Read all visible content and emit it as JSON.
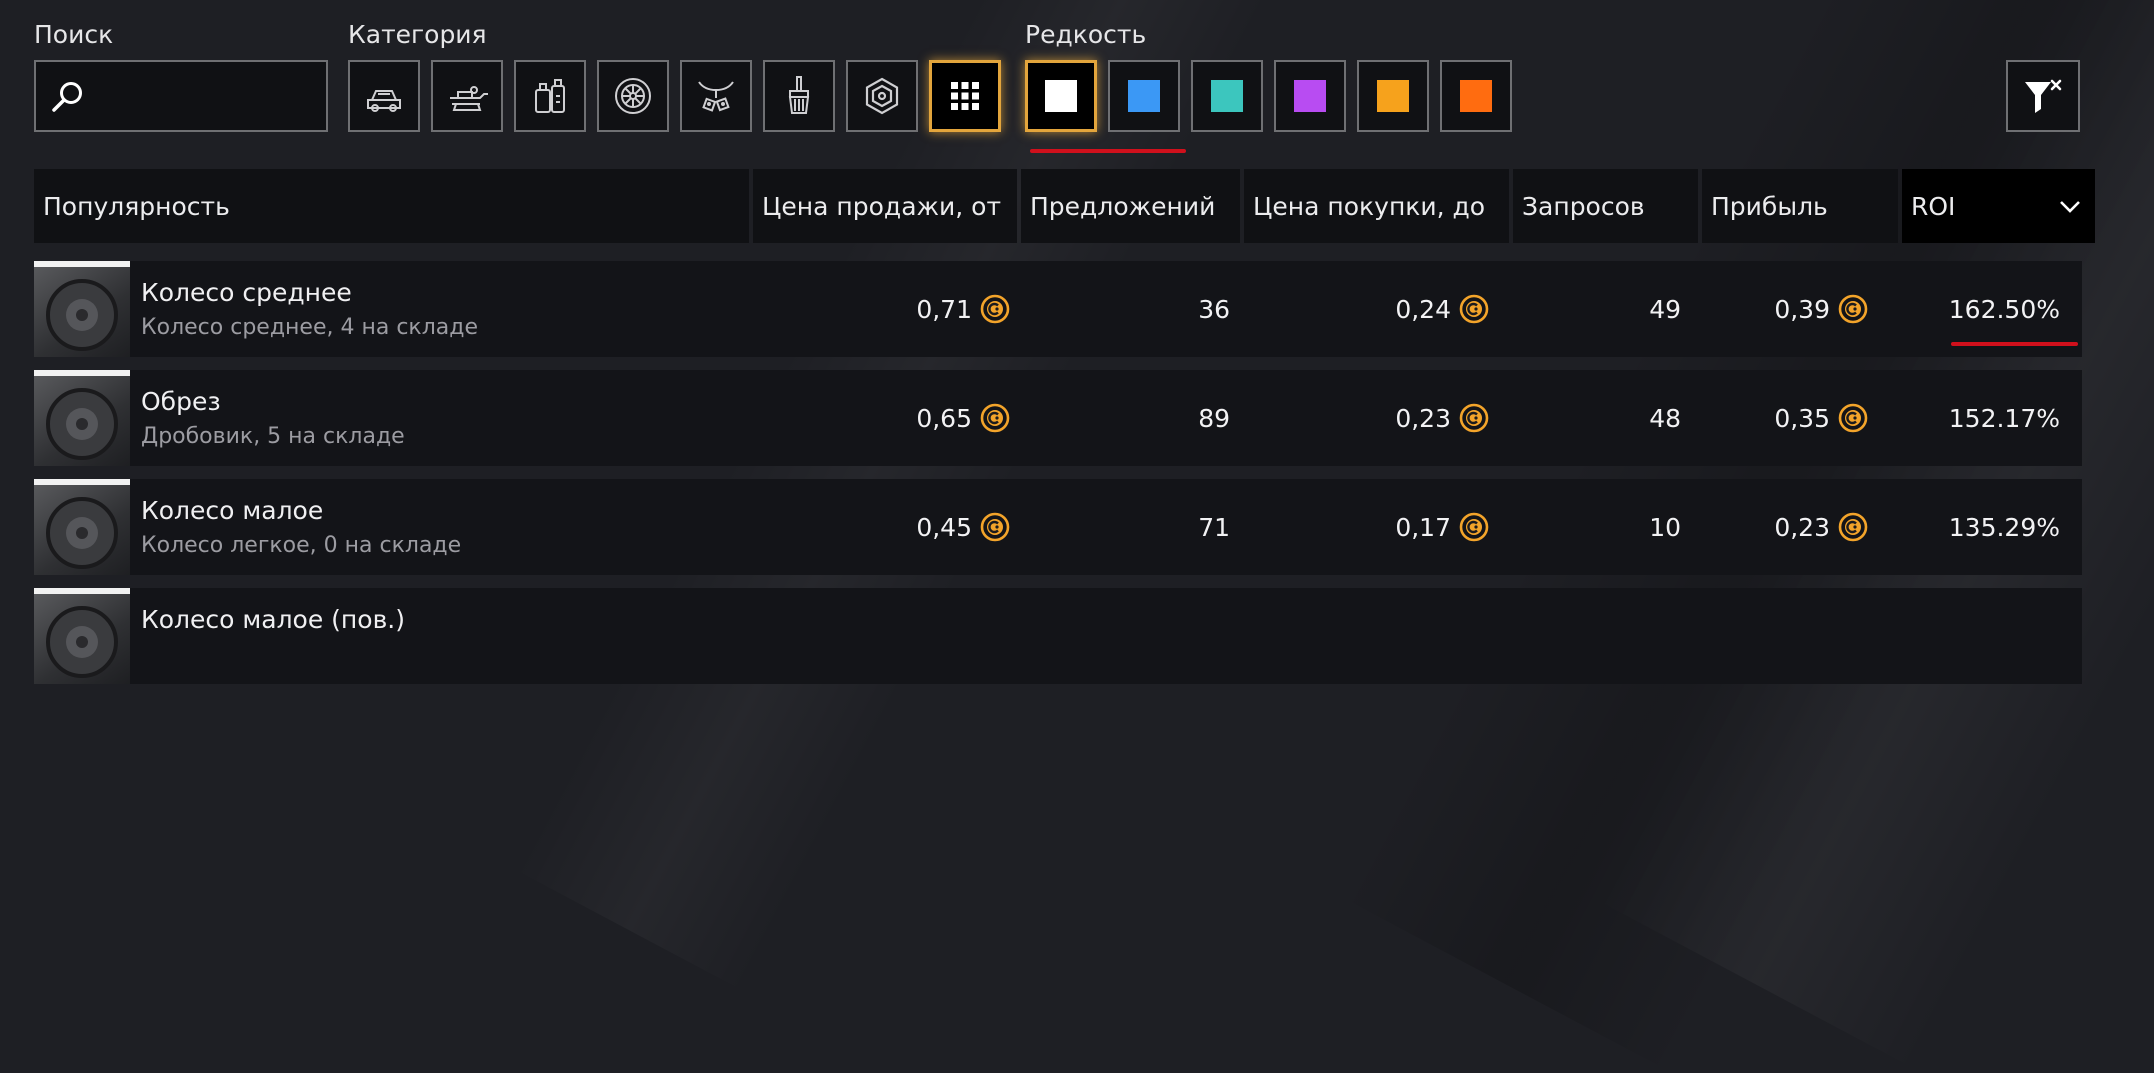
{
  "filters": {
    "search_label": "Поиск",
    "search_value": "",
    "category_label": "Категория",
    "categories": [
      {
        "icon": "car-icon"
      },
      {
        "icon": "weapon-icon"
      },
      {
        "icon": "fuel-icon"
      },
      {
        "icon": "wheel-icon"
      },
      {
        "icon": "decor-icon"
      },
      {
        "icon": "paint-brush-icon"
      },
      {
        "icon": "resource-icon"
      },
      {
        "icon": "grid-all-icon",
        "selected": true
      }
    ],
    "rarity_label": "Редкость",
    "rarities": [
      {
        "color": "#ffffff",
        "selected": true
      },
      {
        "color": "#3b98f5"
      },
      {
        "color": "#3cc6be"
      },
      {
        "color": "#b84cf2"
      },
      {
        "color": "#f6a21c"
      },
      {
        "color": "#ff6c10"
      }
    ],
    "reset_icon": "filter-reset-icon",
    "accent_color": "#e3a53c",
    "underline_color": "#d0101c"
  },
  "table": {
    "headers": {
      "popularity": "Популярность",
      "sell_price": "Цена продажи, от",
      "offers": "Предложений",
      "buy_price": "Цена покупки, до",
      "requests": "Запросов",
      "profit": "Прибыль",
      "roi": "ROI"
    },
    "sort_icon": "chevron-down-icon",
    "rows": [
      {
        "name": "Колесо среднее",
        "sub": "Колесо среднее, 4 на складе",
        "sell": "0,71",
        "offers": "36",
        "buy": "0,24",
        "requests": "49",
        "profit": "0,39",
        "roi": "162.50%"
      },
      {
        "name": "Обрез",
        "sub": "Дробовик, 5 на складе",
        "sell": "0,65",
        "offers": "89",
        "buy": "0,23",
        "requests": "48",
        "profit": "0,35",
        "roi": "152.17%"
      },
      {
        "name": "Колесо малое",
        "sub": "Колесо легкое, 0 на складе",
        "sell": "0,45",
        "offers": "71",
        "buy": "0,17",
        "requests": "10",
        "profit": "0,23",
        "roi": "135.29%"
      },
      {
        "name": "Колесо малое (пов.)",
        "sub": "",
        "sell": "",
        "offers": "",
        "buy": "",
        "requests": "",
        "profit": "",
        "roi": ""
      }
    ]
  }
}
